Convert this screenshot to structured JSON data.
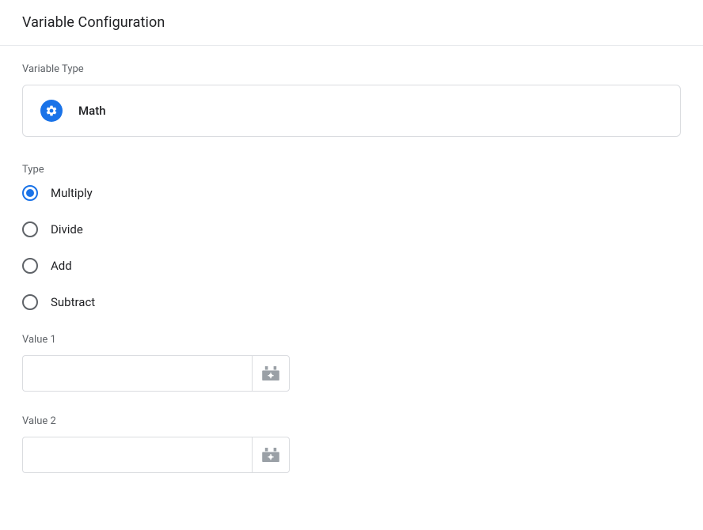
{
  "header": {
    "title": "Variable Configuration"
  },
  "variableType": {
    "label": "Variable Type",
    "selected": "Math"
  },
  "typeRadios": {
    "label": "Type",
    "options": [
      {
        "label": "Multiply",
        "selected": true
      },
      {
        "label": "Divide",
        "selected": false
      },
      {
        "label": "Add",
        "selected": false
      },
      {
        "label": "Subtract",
        "selected": false
      }
    ]
  },
  "fields": {
    "value1": {
      "label": "Value 1",
      "value": ""
    },
    "value2": {
      "label": "Value 2",
      "value": ""
    }
  }
}
